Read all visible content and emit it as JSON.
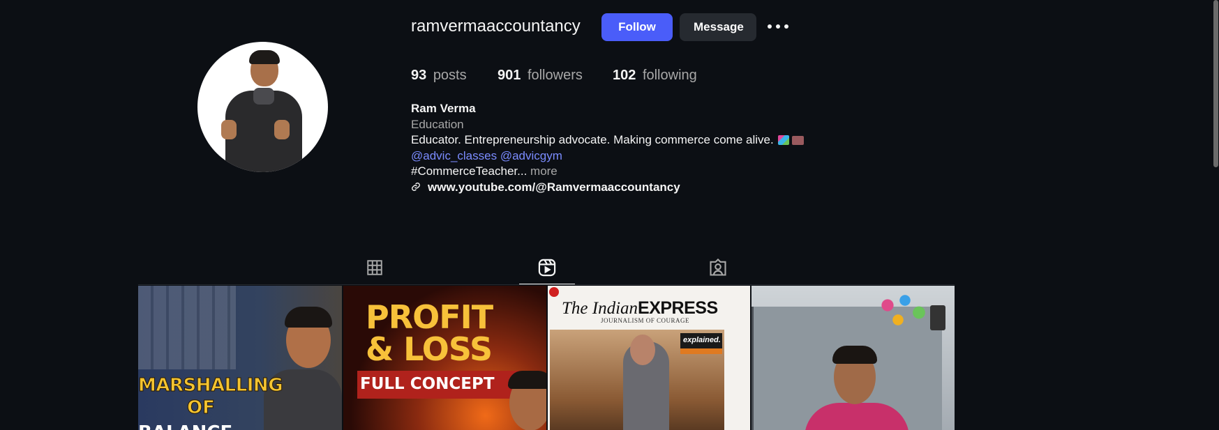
{
  "profile": {
    "username": "ramvermaaccountancy",
    "follow_label": "Follow",
    "message_label": "Message",
    "more_icon": "more-horizontal-icon"
  },
  "stats": {
    "posts_count": "93",
    "posts_label": "posts",
    "followers_count": "901",
    "followers_label": "followers",
    "following_count": "102",
    "following_label": "following"
  },
  "bio": {
    "name": "Ram Verma",
    "category": "Education",
    "description": "Educator. Entrepreneurship advocate. Making commerce come alive.",
    "mention_1": "@advic_classes",
    "mention_2": "@advicgym",
    "hashtag_text": "#CommerceTeacher...",
    "more_label": "more",
    "link": "www.youtube.com/@Ramvermaaccountancy"
  },
  "tabs": [
    {
      "name": "posts",
      "icon": "grid-icon",
      "active": false
    },
    {
      "name": "reels",
      "icon": "reels-icon",
      "active": true
    },
    {
      "name": "tagged",
      "icon": "tagged-icon",
      "active": false
    }
  ],
  "posts": [
    {
      "line1": "MARSHALLING",
      "line2": "OF",
      "line3": "BALANCE"
    },
    {
      "line1": "PROFIT",
      "line2": "& LOSS",
      "line3": "FULL CONCEPT"
    },
    {
      "logo_the": "The",
      "logo_indian": "Indian",
      "logo_express": "EXPRESS",
      "tagline": "JOURNALISM OF COURAGE",
      "badge": "explained."
    },
    {}
  ],
  "colors": {
    "background": "#0c0f14",
    "accent": "#4a5df9",
    "link": "#7b8cff",
    "muted": "#a8a8a8"
  }
}
